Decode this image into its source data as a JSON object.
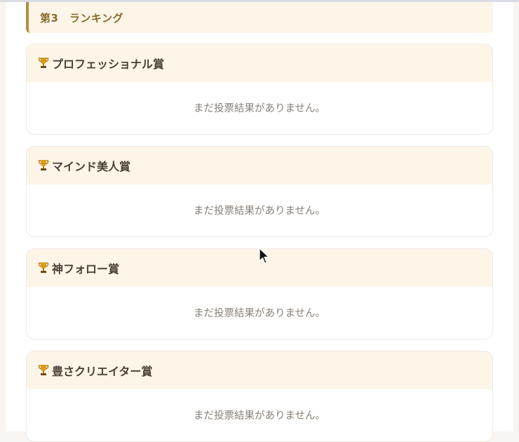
{
  "section": {
    "title": "第3　ランキング"
  },
  "awards": [
    {
      "title": "プロフェッショナル賞",
      "message": "まだ投票結果がありません。",
      "icon": "trophy-icon"
    },
    {
      "title": "マインド美人賞",
      "message": "まだ投票結果がありません。",
      "icon": "trophy-icon"
    },
    {
      "title": "神フォロー賞",
      "message": "まだ投票結果がありません。",
      "icon": "trophy-icon"
    },
    {
      "title": "豊さクリエイター賞",
      "message": "まだ投票結果がありません。",
      "icon": "trophy-icon"
    }
  ],
  "colors": {
    "accent": "#b48d3e",
    "header_bg": "#fdf5e8",
    "trophy": "#c9901e"
  }
}
